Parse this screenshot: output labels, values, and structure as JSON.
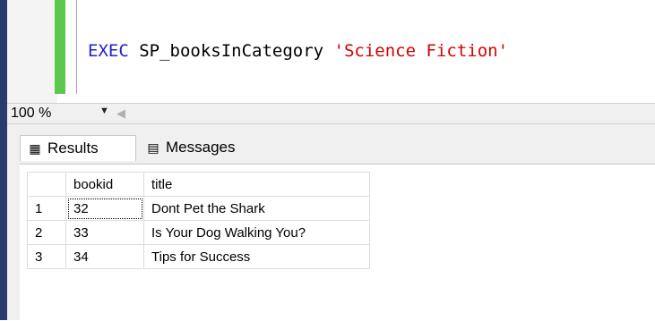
{
  "editor": {
    "keyword": "EXEC",
    "procedure": " SP_booksInCategory ",
    "argument": "'Science Fiction'"
  },
  "zoom": {
    "level": "100 %"
  },
  "tabs": [
    {
      "label": "Results",
      "icon": "grid-icon"
    },
    {
      "label": "Messages",
      "icon": "messages-icon"
    }
  ],
  "results": {
    "columns": [
      "bookid",
      "title"
    ],
    "rows": [
      {
        "num": "1",
        "bookid": "32",
        "title": "Dont Pet the Shark"
      },
      {
        "num": "2",
        "bookid": "33",
        "title": "Is Your Dog Walking You?"
      },
      {
        "num": "3",
        "bookid": "34",
        "title": "Tips for Success"
      }
    ]
  },
  "colors": {
    "keyword": "#1f1fcf",
    "string": "#d40000",
    "change_bar": "#5cc94e"
  }
}
